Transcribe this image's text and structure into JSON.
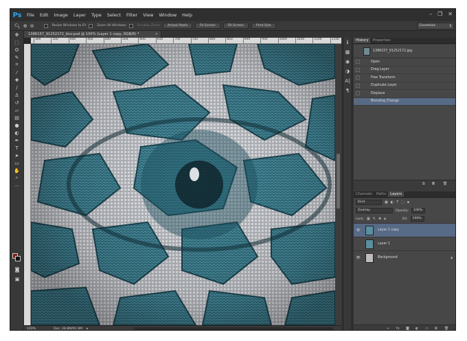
{
  "app": {
    "logo": "Ps"
  },
  "menu": [
    "File",
    "Edit",
    "Image",
    "Layer",
    "Type",
    "Select",
    "Filter",
    "View",
    "Window",
    "Help"
  ],
  "window_controls": [
    "–",
    "❐",
    "✕"
  ],
  "options_bar": {
    "resize_windows": "Resize Windows to Fit",
    "zoom_all": "Zoom All Windows",
    "scrubby_zoom": "Scrubby Zoom",
    "buttons": [
      "Actual Pixels",
      "Fit Screen",
      "Fill Screen",
      "Print Size"
    ],
    "workspace": "Essentials"
  },
  "document": {
    "tab_title": "1386157_91252172_blur.psd @ 100% (Layer 1 copy, RGB/8) *",
    "ruler_ticks": [
      "300",
      "350",
      "400",
      "450",
      "500",
      "550",
      "600",
      "650",
      "700",
      "750",
      "800",
      "850",
      "900",
      "950",
      "1000",
      "1050",
      "1100",
      "1150"
    ],
    "zoom": "100%",
    "doc_size": "Doc: 28.8M/91.9M"
  },
  "history": {
    "tabs": [
      "History",
      "Properties"
    ],
    "snapshot": "1386157_91252172.jpg",
    "states": [
      "Open",
      "Drag Layer",
      "Free Transform",
      "Duplicate Layer",
      "Displace",
      "Blending Change"
    ],
    "selected_index": 5
  },
  "layers_panel": {
    "tabs": [
      "Channels",
      "Paths",
      "Layers"
    ],
    "kind_label": "Kind",
    "blend_mode": "Overlay",
    "opacity_label": "Opacity:",
    "opacity": "100%",
    "lock_label": "Lock:",
    "fill_label": "Fill:",
    "fill": "100%",
    "layers": [
      {
        "name": "Layer 1 copy",
        "visible": true,
        "selected": true
      },
      {
        "name": "Layer 1",
        "visible": false,
        "selected": false
      },
      {
        "name": "Background",
        "visible": true,
        "selected": false,
        "locked": true
      }
    ]
  },
  "colors": {
    "accent": "#576a86",
    "lace_teal": "#2f6f80",
    "foreground": "#7a2018",
    "background": "#111111"
  }
}
